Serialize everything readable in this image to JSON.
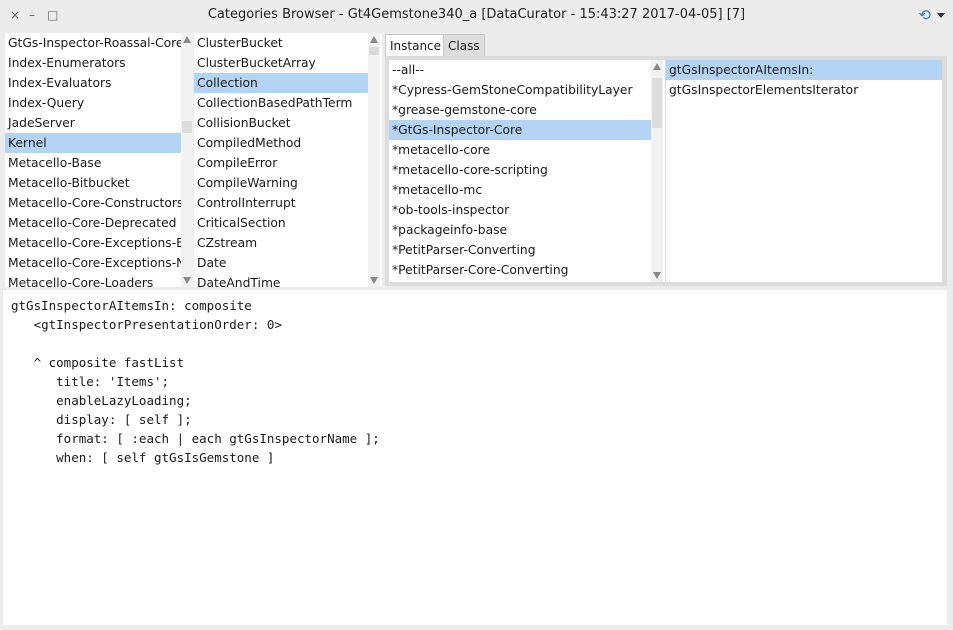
{
  "window": {
    "title": "Categories Browser - Gt4Gemstone340_a [DataCurator - 15:43:27 2017-04-05] [7]",
    "close_glyph": "×",
    "minimize_glyph": "–",
    "maximize_glyph": "□",
    "refresh_glyph": "⟲"
  },
  "packages": {
    "items": [
      "GtGs-Inspector-Roassal-Core",
      "Index-Enumerators",
      "Index-Evaluators",
      "Index-Query",
      "JadeServer",
      "Kernel",
      "Metacello-Base",
      "Metacello-Bitbucket",
      "Metacello-Core-Constructors",
      "Metacello-Core-Deprecated",
      "Metacello-Core-Exceptions-Erro",
      "Metacello-Core-Exceptions-Noti",
      "Metacello-Core-Loaders"
    ],
    "selected": 5
  },
  "classes": {
    "items": [
      "ClusterBucket",
      "ClusterBucketArray",
      "Collection",
      "CollectionBasedPathTerm",
      "CollisionBucket",
      "CompiledMethod",
      "CompileError",
      "CompileWarning",
      "ControlInterrupt",
      "CriticalSection",
      "CZstream",
      "Date",
      "DateAndTime"
    ],
    "selected": 2
  },
  "tabs": [
    "Instance",
    "Class"
  ],
  "active_tab": 0,
  "categories": {
    "items": [
      "--all--",
      "*Cypress-GemStoneCompatibilityLayer",
      "*grease-gemstone-core",
      "*GtGs-Inspector-Core",
      "*metacello-core",
      "*metacello-core-scripting",
      "*metacello-mc",
      "*ob-tools-inspector",
      "*packageinfo-base",
      "*PetitParser-Converting",
      "*PetitParser-Core-Converting"
    ],
    "selected": 3
  },
  "methods": {
    "items": [
      "gtGsInspectorAItemsIn:",
      "gtGsInspectorElementsIterator"
    ],
    "selected": 0
  },
  "source": {
    "lines": [
      "gtGsInspectorAItemsIn: composite",
      "   <gtInspectorPresentationOrder: 0>",
      "",
      "   ^ composite fastList",
      "      title: 'Items';",
      "      enableLazyLoading;",
      "      display: [ self ];",
      "      format: [ :each | each gtGsInspectorName ];",
      "      when: [ self gtGsIsGemstone ]"
    ]
  }
}
